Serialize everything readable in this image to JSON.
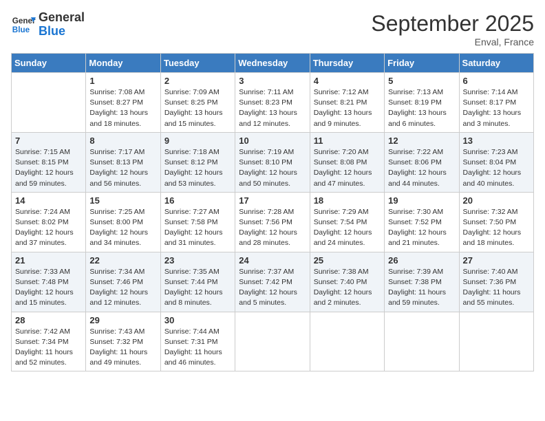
{
  "logo": {
    "line1": "General",
    "line2": "Blue"
  },
  "title": "September 2025",
  "location": "Enval, France",
  "days_of_week": [
    "Sunday",
    "Monday",
    "Tuesday",
    "Wednesday",
    "Thursday",
    "Friday",
    "Saturday"
  ],
  "weeks": [
    [
      {
        "day": "",
        "info": ""
      },
      {
        "day": "1",
        "info": "Sunrise: 7:08 AM\nSunset: 8:27 PM\nDaylight: 13 hours\nand 18 minutes."
      },
      {
        "day": "2",
        "info": "Sunrise: 7:09 AM\nSunset: 8:25 PM\nDaylight: 13 hours\nand 15 minutes."
      },
      {
        "day": "3",
        "info": "Sunrise: 7:11 AM\nSunset: 8:23 PM\nDaylight: 13 hours\nand 12 minutes."
      },
      {
        "day": "4",
        "info": "Sunrise: 7:12 AM\nSunset: 8:21 PM\nDaylight: 13 hours\nand 9 minutes."
      },
      {
        "day": "5",
        "info": "Sunrise: 7:13 AM\nSunset: 8:19 PM\nDaylight: 13 hours\nand 6 minutes."
      },
      {
        "day": "6",
        "info": "Sunrise: 7:14 AM\nSunset: 8:17 PM\nDaylight: 13 hours\nand 3 minutes."
      }
    ],
    [
      {
        "day": "7",
        "info": "Sunrise: 7:15 AM\nSunset: 8:15 PM\nDaylight: 12 hours\nand 59 minutes."
      },
      {
        "day": "8",
        "info": "Sunrise: 7:17 AM\nSunset: 8:13 PM\nDaylight: 12 hours\nand 56 minutes."
      },
      {
        "day": "9",
        "info": "Sunrise: 7:18 AM\nSunset: 8:12 PM\nDaylight: 12 hours\nand 53 minutes."
      },
      {
        "day": "10",
        "info": "Sunrise: 7:19 AM\nSunset: 8:10 PM\nDaylight: 12 hours\nand 50 minutes."
      },
      {
        "day": "11",
        "info": "Sunrise: 7:20 AM\nSunset: 8:08 PM\nDaylight: 12 hours\nand 47 minutes."
      },
      {
        "day": "12",
        "info": "Sunrise: 7:22 AM\nSunset: 8:06 PM\nDaylight: 12 hours\nand 44 minutes."
      },
      {
        "day": "13",
        "info": "Sunrise: 7:23 AM\nSunset: 8:04 PM\nDaylight: 12 hours\nand 40 minutes."
      }
    ],
    [
      {
        "day": "14",
        "info": "Sunrise: 7:24 AM\nSunset: 8:02 PM\nDaylight: 12 hours\nand 37 minutes."
      },
      {
        "day": "15",
        "info": "Sunrise: 7:25 AM\nSunset: 8:00 PM\nDaylight: 12 hours\nand 34 minutes."
      },
      {
        "day": "16",
        "info": "Sunrise: 7:27 AM\nSunset: 7:58 PM\nDaylight: 12 hours\nand 31 minutes."
      },
      {
        "day": "17",
        "info": "Sunrise: 7:28 AM\nSunset: 7:56 PM\nDaylight: 12 hours\nand 28 minutes."
      },
      {
        "day": "18",
        "info": "Sunrise: 7:29 AM\nSunset: 7:54 PM\nDaylight: 12 hours\nand 24 minutes."
      },
      {
        "day": "19",
        "info": "Sunrise: 7:30 AM\nSunset: 7:52 PM\nDaylight: 12 hours\nand 21 minutes."
      },
      {
        "day": "20",
        "info": "Sunrise: 7:32 AM\nSunset: 7:50 PM\nDaylight: 12 hours\nand 18 minutes."
      }
    ],
    [
      {
        "day": "21",
        "info": "Sunrise: 7:33 AM\nSunset: 7:48 PM\nDaylight: 12 hours\nand 15 minutes."
      },
      {
        "day": "22",
        "info": "Sunrise: 7:34 AM\nSunset: 7:46 PM\nDaylight: 12 hours\nand 12 minutes."
      },
      {
        "day": "23",
        "info": "Sunrise: 7:35 AM\nSunset: 7:44 PM\nDaylight: 12 hours\nand 8 minutes."
      },
      {
        "day": "24",
        "info": "Sunrise: 7:37 AM\nSunset: 7:42 PM\nDaylight: 12 hours\nand 5 minutes."
      },
      {
        "day": "25",
        "info": "Sunrise: 7:38 AM\nSunset: 7:40 PM\nDaylight: 12 hours\nand 2 minutes."
      },
      {
        "day": "26",
        "info": "Sunrise: 7:39 AM\nSunset: 7:38 PM\nDaylight: 11 hours\nand 59 minutes."
      },
      {
        "day": "27",
        "info": "Sunrise: 7:40 AM\nSunset: 7:36 PM\nDaylight: 11 hours\nand 55 minutes."
      }
    ],
    [
      {
        "day": "28",
        "info": "Sunrise: 7:42 AM\nSunset: 7:34 PM\nDaylight: 11 hours\nand 52 minutes."
      },
      {
        "day": "29",
        "info": "Sunrise: 7:43 AM\nSunset: 7:32 PM\nDaylight: 11 hours\nand 49 minutes."
      },
      {
        "day": "30",
        "info": "Sunrise: 7:44 AM\nSunset: 7:31 PM\nDaylight: 11 hours\nand 46 minutes."
      },
      {
        "day": "",
        "info": ""
      },
      {
        "day": "",
        "info": ""
      },
      {
        "day": "",
        "info": ""
      },
      {
        "day": "",
        "info": ""
      }
    ]
  ]
}
